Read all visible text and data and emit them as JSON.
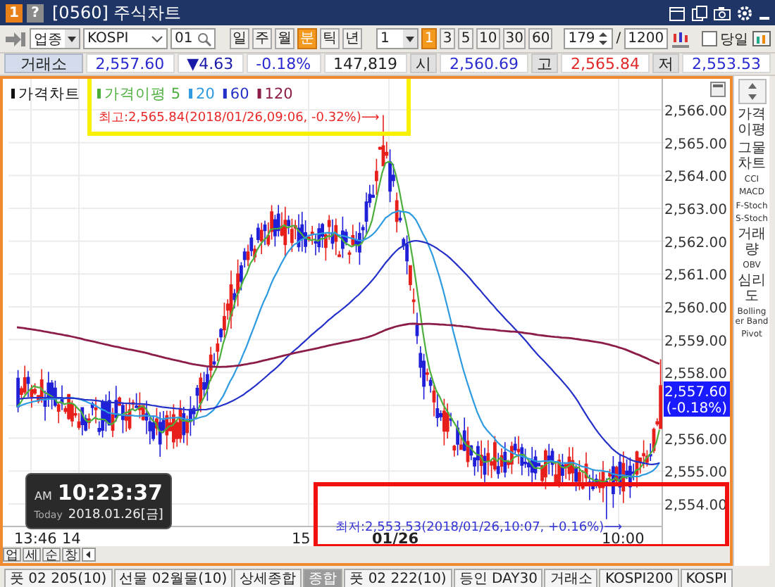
{
  "window": {
    "title": "[0560] 주식차트",
    "badge": "1",
    "help": "?"
  },
  "toolbar": {
    "market": "업종",
    "symbol": "KOSPI",
    "code": "01",
    "periods": [
      {
        "label": "일",
        "selected": false
      },
      {
        "label": "주",
        "selected": false
      },
      {
        "label": "월",
        "selected": false
      },
      {
        "label": "분",
        "selected": true
      },
      {
        "label": "틱",
        "selected": false
      },
      {
        "label": "년",
        "selected": false
      }
    ],
    "interval": "1",
    "intervals": [
      {
        "label": "1",
        "selected": true
      },
      {
        "label": "3",
        "selected": false
      },
      {
        "label": "5",
        "selected": false
      },
      {
        "label": "10",
        "selected": false
      },
      {
        "label": "30",
        "selected": false
      },
      {
        "label": "60",
        "selected": false
      }
    ],
    "count": "179",
    "separator": "/",
    "max": "1200",
    "today": {
      "label": "당일",
      "checked": false
    }
  },
  "quote": {
    "exchange": "거래소",
    "fields": [
      {
        "text": "2,557.60",
        "kind": "value",
        "color": "#2a2ad0"
      },
      {
        "text": "▼4.63",
        "kind": "value",
        "color": "#1a1aa8"
      },
      {
        "text": "-0.18%",
        "kind": "value",
        "color": "#2a2ad0"
      },
      {
        "text": "147,819",
        "kind": "value",
        "color": "#222222"
      },
      {
        "text": "시",
        "kind": "label",
        "color": "#222222"
      },
      {
        "text": "2,560.69",
        "kind": "value",
        "color": "#2a2ad0"
      },
      {
        "text": "고",
        "kind": "label",
        "color": "#222222"
      },
      {
        "text": "2,565.84",
        "kind": "value",
        "color": "#e02828"
      },
      {
        "text": "저",
        "kind": "label",
        "color": "#222222"
      },
      {
        "text": "2,553.53",
        "kind": "value",
        "color": "#2a2ad0"
      }
    ]
  },
  "chart": {
    "legend": [
      {
        "label": "가격차트",
        "color": "#111111"
      },
      {
        "label": "가격이평 5",
        "color": "#4caf3c"
      },
      {
        "label": "20",
        "color": "#2e9be0"
      },
      {
        "label": "60",
        "color": "#2430c8"
      },
      {
        "label": "120",
        "color": "#8c1c48"
      }
    ],
    "high_note": "최고:2,565.84(2018/01/26,09:06, -0.32%)⟶",
    "low_note": "최저:2,553.53(2018/01/26,10:07, +0.16%)⟶",
    "y_labels": [
      "2,566.00",
      "2,565.00",
      "2,564.00",
      "2,563.00",
      "2,562.00",
      "2,561.00",
      "2,560.00",
      "2,559.00",
      "2,558.00",
      "2,556.00",
      "2,555.00",
      "2,554.00"
    ],
    "x_labels": [
      {
        "text": "13:46",
        "kind": "time"
      },
      {
        "text": "14",
        "kind": "time"
      },
      {
        "text": "15",
        "kind": "time"
      },
      {
        "text": "01/26",
        "kind": "date"
      },
      {
        "text": "10:00",
        "kind": "time"
      }
    ],
    "last_price": "2,557.60",
    "last_change": "(-0.18%)",
    "clock": {
      "ampm": "AM",
      "time": "10:23:37",
      "today": "Today",
      "date": "2018.01.26[금]"
    },
    "mini_tabs": [
      "업",
      "세",
      "순",
      "창"
    ]
  },
  "indicators": [
    "가격이평",
    "그물차트",
    "CCI",
    "MACD",
    "F-Stoch",
    "S-Stoch",
    "거래량",
    "OBV",
    "심리도",
    "Bollinger Band",
    "Pivot"
  ],
  "bottom_tabs": [
    {
      "label": "풋 02 205(10)",
      "selected": false
    },
    {
      "label": "선물 02월물(10)",
      "selected": false
    },
    {
      "label": "상세종합",
      "selected": false
    },
    {
      "label": "종합",
      "selected": true
    },
    {
      "label": "풋 02 222(10)",
      "selected": false
    },
    {
      "label": "등인 DAY30",
      "selected": false
    },
    {
      "label": "거래소",
      "selected": false
    },
    {
      "label": "KOSPI200",
      "selected": false
    },
    {
      "label": "KOSPI",
      "selected": false
    }
  ]
}
